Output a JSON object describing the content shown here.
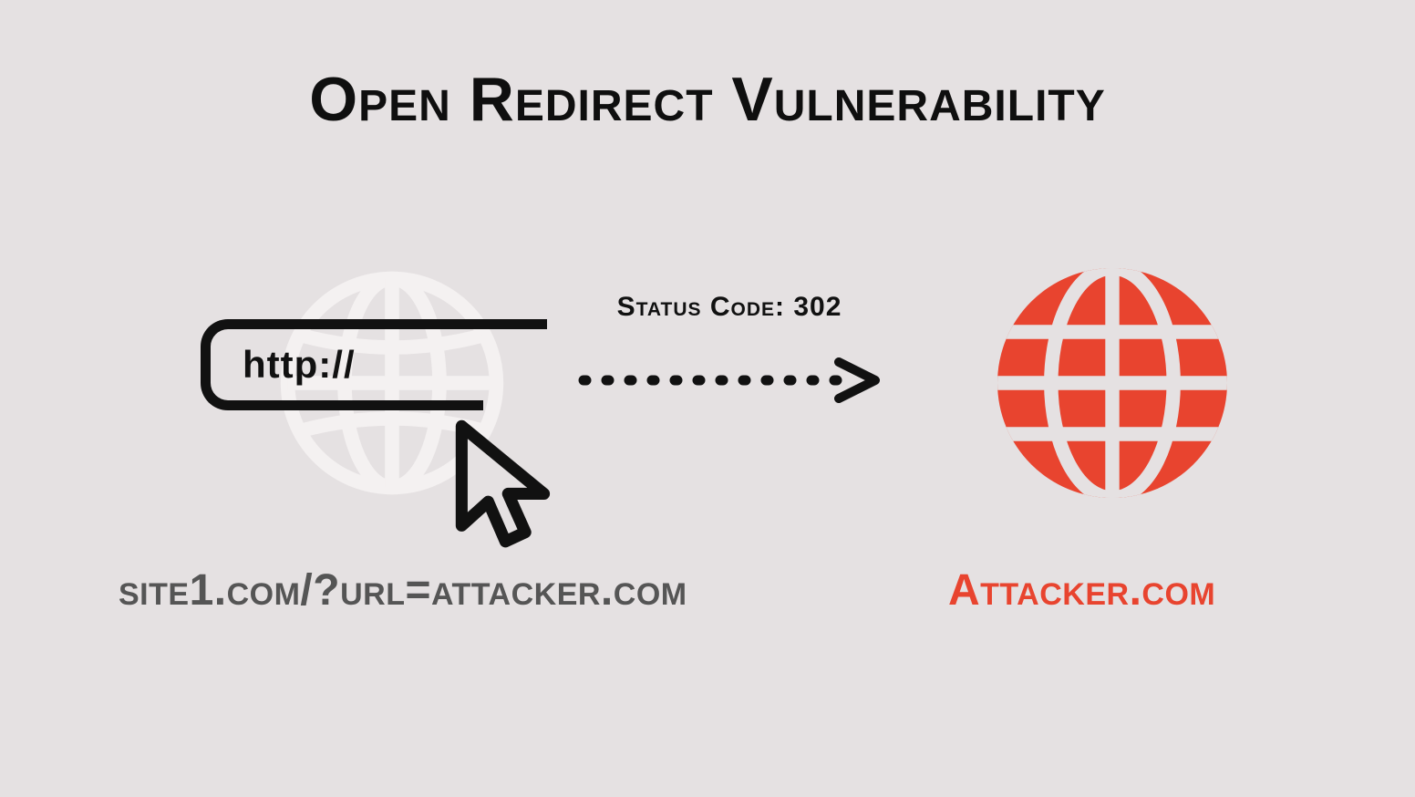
{
  "title": "Open Redirect Vulnerability",
  "source": {
    "protocol_label": "http://",
    "url_caption": "site1.com/?url=attacker.com"
  },
  "arrow": {
    "status_label": "Status Code: 302"
  },
  "target": {
    "url_caption": "Attacker.com"
  },
  "colors": {
    "accent_red": "#e8442f",
    "text_dark": "#111111",
    "text_gray": "#555555",
    "bg": "#e5e1e2",
    "globe_light": "#f4f1f1"
  }
}
